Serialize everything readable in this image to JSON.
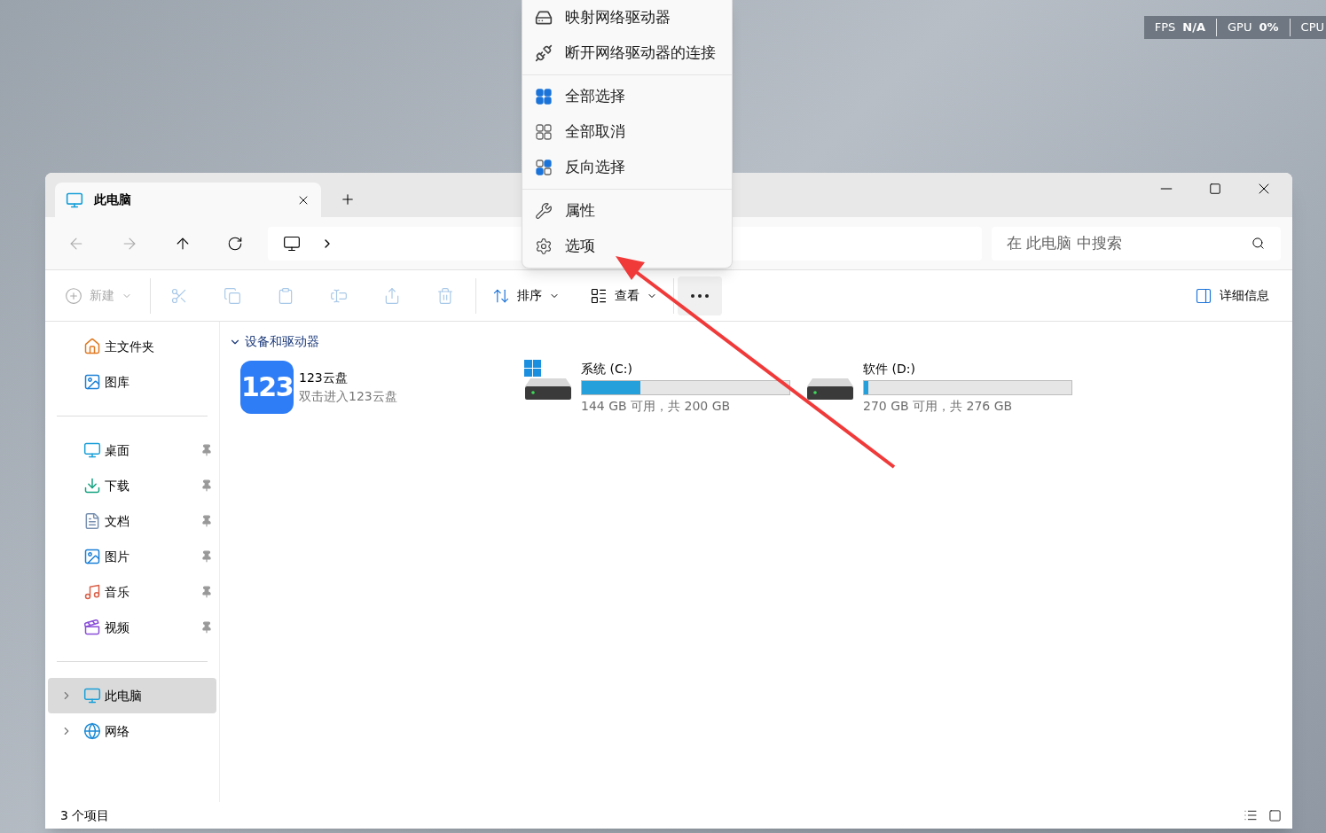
{
  "overlay_stats": [
    {
      "label": "FPS",
      "value": "N/A"
    },
    {
      "label": "GPU",
      "value": "0%"
    },
    {
      "label": "CPU"
    }
  ],
  "context_menu": {
    "groups": [
      [
        {
          "kind": "map-drive",
          "label": "映射网络驱动器"
        },
        {
          "kind": "disconnect-drive",
          "label": "断开网络驱动器的连接"
        }
      ],
      [
        {
          "kind": "select-all",
          "label": "全部选择"
        },
        {
          "kind": "select-none",
          "label": "全部取消"
        },
        {
          "kind": "invert-selection",
          "label": "反向选择"
        }
      ],
      [
        {
          "kind": "properties",
          "label": "属性"
        },
        {
          "kind": "options",
          "label": "选项"
        }
      ]
    ]
  },
  "window": {
    "tabs": [
      {
        "title": "此电脑",
        "selected": true
      }
    ],
    "search": {
      "placeholder": "在 此电脑 中搜索"
    },
    "toolbar": {
      "new_button": {
        "label": "新建",
        "disabled": true
      },
      "actions": [
        {
          "kind": "cut",
          "disabled": true
        },
        {
          "kind": "copy",
          "disabled": true
        },
        {
          "kind": "paste",
          "disabled": true
        },
        {
          "kind": "rename",
          "disabled": true
        },
        {
          "kind": "share",
          "disabled": true
        },
        {
          "kind": "delete",
          "disabled": true
        }
      ],
      "sort": {
        "label": "排序"
      },
      "view": {
        "label": "查看"
      },
      "more": {
        "selected": true
      },
      "details": {
        "label": "详细信息"
      }
    },
    "sidebar": {
      "sections": [
        [
          {
            "kind": "home",
            "label": "主文件夹",
            "pinned": false,
            "expandable": false,
            "selected": false
          },
          {
            "kind": "gallery",
            "label": "图库",
            "pinned": false,
            "expandable": false,
            "selected": false
          }
        ],
        [
          {
            "kind": "desktop",
            "label": "桌面",
            "pinned": true,
            "expandable": false,
            "selected": false
          },
          {
            "kind": "downloads",
            "label": "下载",
            "pinned": true,
            "expandable": false,
            "selected": false
          },
          {
            "kind": "documents",
            "label": "文档",
            "pinned": true,
            "expandable": false,
            "selected": false
          },
          {
            "kind": "pictures",
            "label": "图片",
            "pinned": true,
            "expandable": false,
            "selected": false
          },
          {
            "kind": "music",
            "label": "音乐",
            "pinned": true,
            "expandable": false,
            "selected": false
          },
          {
            "kind": "videos",
            "label": "视频",
            "pinned": true,
            "expandable": false,
            "selected": false
          }
        ],
        [
          {
            "kind": "pc",
            "label": "此电脑",
            "pinned": false,
            "expandable": true,
            "selected": true
          },
          {
            "kind": "network",
            "label": "网络",
            "pinned": false,
            "expandable": true,
            "selected": false
          }
        ]
      ]
    },
    "content": {
      "group": {
        "title": "设备和驱动器",
        "expanded": true,
        "items": [
          {
            "kind": "app",
            "logo_text": "123",
            "name": "123云盘",
            "subtitle": "双击进入123云盘"
          },
          {
            "kind": "drive",
            "system": true,
            "name": "系统 (C:)",
            "level": 0.28,
            "reading": "144 GB 可用，共 200 GB"
          },
          {
            "kind": "drive",
            "system": false,
            "name": "软件 (D:)",
            "level": 0.022,
            "reading": "270 GB 可用，共 276 GB"
          }
        ]
      }
    },
    "status_bar": {
      "count": "3 个项目"
    }
  }
}
